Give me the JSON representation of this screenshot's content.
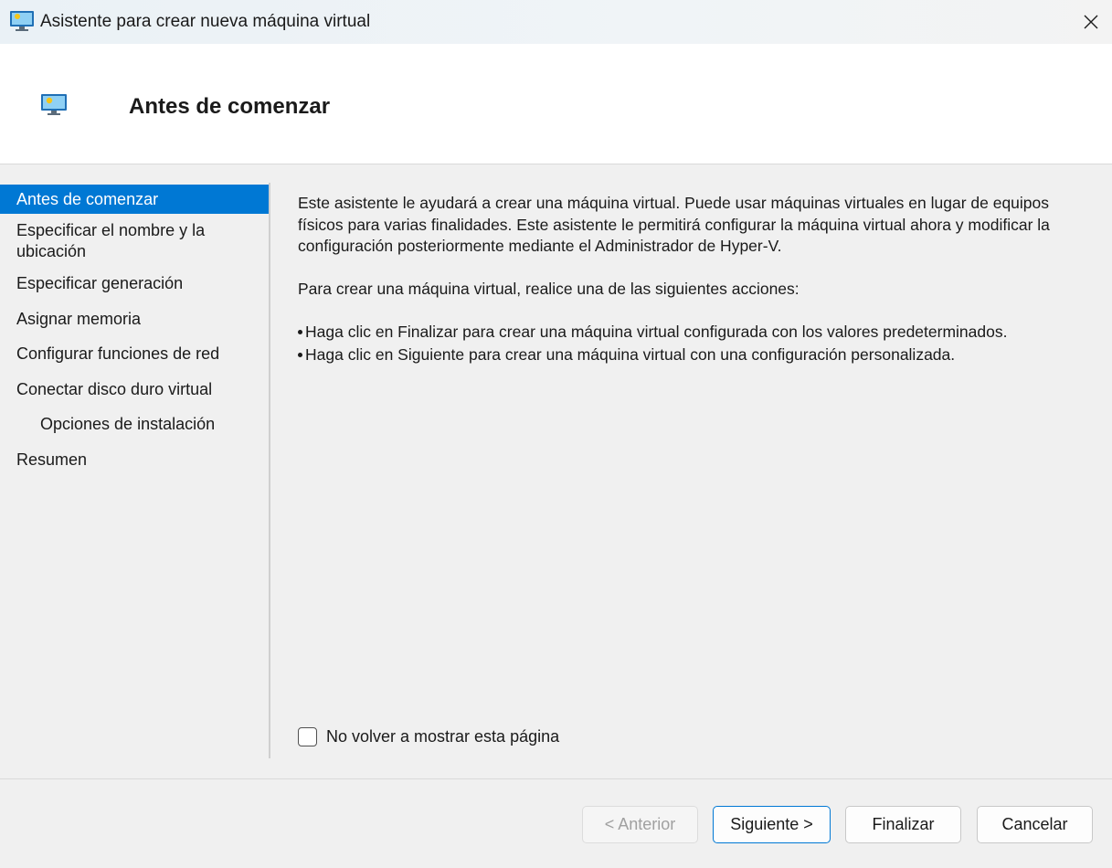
{
  "window": {
    "title": "Asistente para crear nueva máquina virtual",
    "icon": "hyper-v-monitor-icon",
    "close_icon": "close-icon"
  },
  "header": {
    "page_title": "Antes de comenzar",
    "icon": "hyper-v-monitor-icon"
  },
  "sidebar": {
    "items": [
      {
        "label": "Antes de comenzar",
        "selected": true
      },
      {
        "label": "Especificar el nombre y la ubicación",
        "selected": false
      },
      {
        "label": "Especificar generación",
        "selected": false
      },
      {
        "label": "Asignar memoria",
        "selected": false
      },
      {
        "label": "Configurar funciones de red",
        "selected": false
      },
      {
        "label": "Conectar disco duro virtual",
        "selected": false
      },
      {
        "label": "Opciones de instalación",
        "selected": false
      },
      {
        "label": "Resumen",
        "selected": false
      }
    ]
  },
  "content": {
    "intro": "Este asistente le ayudará a crear una máquina virtual. Puede usar máquinas virtuales en lugar de equipos físicos para varias finalidades. Este asistente le permitirá configurar la máquina virtual ahora y modificar la configuración posteriormente mediante el Administrador de Hyper-V.",
    "instruction": "Para crear una máquina virtual, realice una de las siguientes acciones:",
    "bullets": [
      "Haga clic en Finalizar para crear una máquina virtual configurada con los valores predeterminados.",
      "Haga clic en Siguiente para crear una máquina virtual con una configuración personalizada."
    ]
  },
  "checkbox": {
    "label": "No volver a mostrar esta página",
    "checked": false
  },
  "buttons": {
    "previous": "< Anterior",
    "next": "Siguiente >",
    "finish": "Finalizar",
    "cancel": "Cancelar"
  },
  "colors": {
    "selection": "#0078d4",
    "background": "#f0f0f0",
    "header_background": "#ffffff"
  }
}
